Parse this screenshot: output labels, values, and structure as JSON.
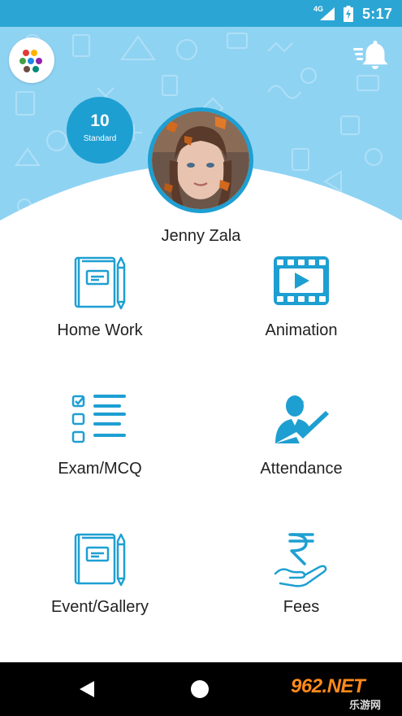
{
  "status_bar": {
    "network": "4G",
    "time": "5:17"
  },
  "header": {
    "apps_icon": "colorful-dots-icon",
    "notification_icon": "bell-with-lines-icon",
    "standard_number": "10",
    "standard_label": "Standard",
    "student_name": "Jenny Zala"
  },
  "menu": {
    "items": [
      {
        "label": "Home Work",
        "icon": "notebook-pencil-icon"
      },
      {
        "label": "Animation",
        "icon": "video-film-icon"
      },
      {
        "label": "Exam/MCQ",
        "icon": "checklist-icon"
      },
      {
        "label": "Attendance",
        "icon": "user-check-icon"
      },
      {
        "label": "Event/Gallery",
        "icon": "notebook-pencil-icon"
      },
      {
        "label": "Fees",
        "icon": "rupee-hand-icon"
      }
    ]
  },
  "navigation": {
    "back_icon": "back-triangle-icon",
    "home_icon": "home-circle-icon"
  },
  "watermark": {
    "top": "962.NET",
    "bottom": "乐游网"
  },
  "colors": {
    "status_bar": "#2ba6d4",
    "header_bg": "#8fd3f3",
    "accent": "#1e9fd2",
    "text": "#222222"
  }
}
